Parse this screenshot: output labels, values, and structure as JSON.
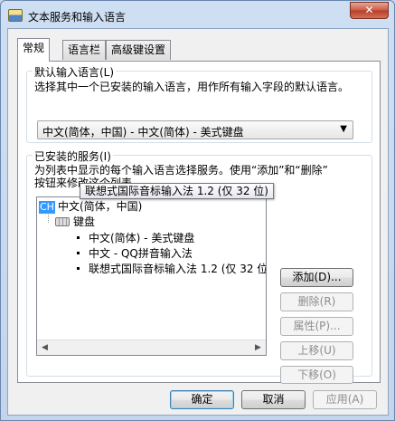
{
  "window": {
    "title": "文本服务和输入语言",
    "close_glyph": "✕"
  },
  "tabs": [
    {
      "label": "常规",
      "active": true
    },
    {
      "label": "语言栏",
      "active": false
    },
    {
      "label": "高级键设置",
      "active": false
    }
  ],
  "default_language": {
    "group_title": "默认输入语言(L)",
    "description": "选择其中一个已安装的输入语言，用作所有输入字段的默认语言。",
    "selected": "中文(简体，中国) - 中文(简体) - 美式键盘",
    "dropdown_glyph": "▼"
  },
  "installed_services": {
    "group_title": "已安装的服务(I)",
    "description_line1": "为列表中显示的每个输入语言选择服务。使用“添加”和“删除”",
    "description_line2": "按钮来修改这个列表。",
    "tree": {
      "language_badge": "CH",
      "language": "中文(简体，中国)",
      "keyboard_label": "键盘",
      "items": [
        "中文(简体) - 美式键盘",
        "中文 - QQ拼音输入法",
        "联想式国际音标输入法 1.2 (仅 32 位)"
      ]
    },
    "tooltip": "联想式国际音标输入法 1.2 (仅 32 位)",
    "scroll_left": "◀",
    "scroll_right": "▶",
    "buttons": {
      "add": "添加(D)...",
      "remove": "删除(R)",
      "properties": "属性(P)...",
      "move_up": "上移(U)",
      "move_down": "下移(O)"
    }
  },
  "footer": {
    "ok": "确定",
    "cancel": "取消",
    "apply": "应用(A)"
  }
}
